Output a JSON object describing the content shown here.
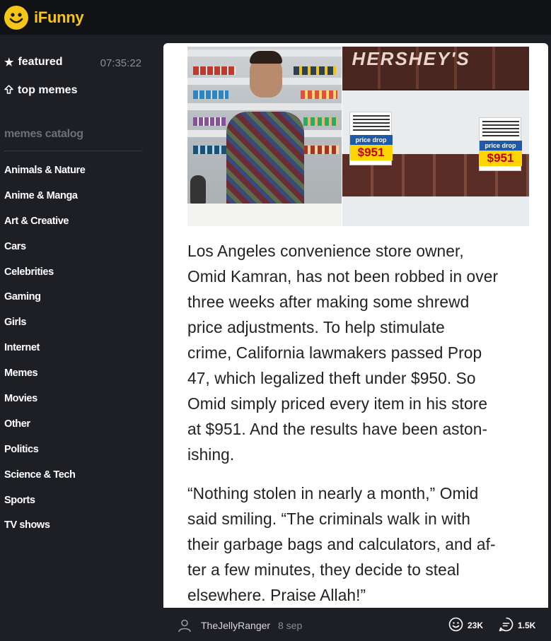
{
  "app": {
    "name": "iFunny",
    "brand_color": "#f5c518"
  },
  "nav": {
    "featured_label": "featured",
    "featured_time": "07:35:22",
    "top_memes_label": "top memes"
  },
  "catalog": {
    "title": "memes catalog",
    "items": [
      "Animals & Nature",
      "Anime & Manga",
      "Art & Creative",
      "Cars",
      "Celebrities",
      "Gaming",
      "Girls",
      "Internet",
      "Memes",
      "Movies",
      "Other",
      "Politics",
      "Science & Tech",
      "Sports",
      "TV shows"
    ]
  },
  "post": {
    "image_text": {
      "brand": "HERSHEY'S",
      "tag_label": "price drop",
      "price": "$951"
    },
    "paragraph1_lines": [
      "Los Angeles convenience store owner,",
      "Omid Kamran, has not been robbed in over",
      "three weeks after making some shrewd",
      "price adjustments.  To help stimulate",
      "crime, California lawmakers passed Prop",
      "47, which legalized theft under $950.  So",
      "Omid simply priced every item in his store",
      "at $951.  And the results have been aston-",
      "ishing."
    ],
    "paragraph2_lines": [
      "“Nothing stolen in nearly a month,” Omid",
      "said smiling.  “The criminals walk in with",
      "their garbage bags and calculators, and af-",
      "ter a few minutes, they decide to steal",
      "elsewhere.  Praise Allah!”"
    ],
    "author": "TheJellyRanger",
    "date": "8 sep",
    "smiles": "23K",
    "comments": "1.5K"
  }
}
